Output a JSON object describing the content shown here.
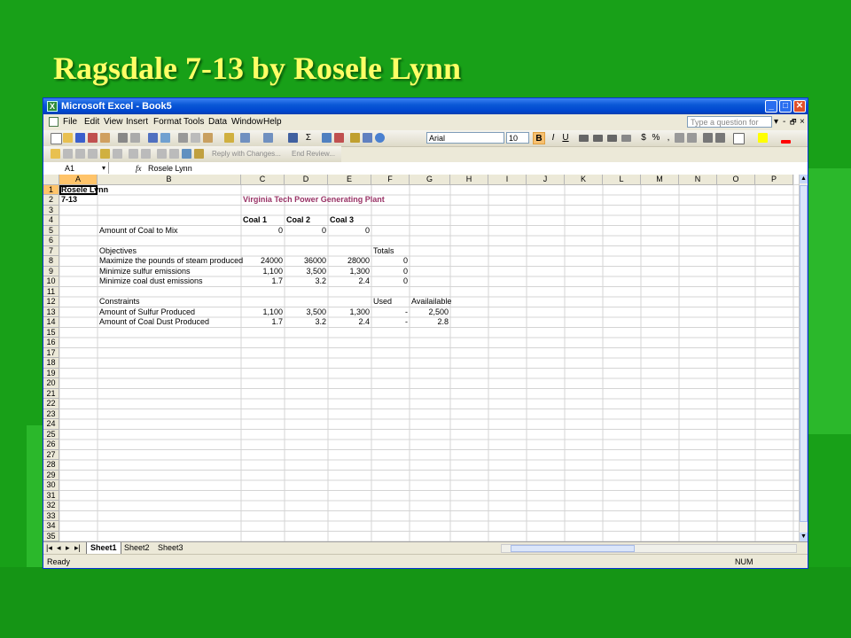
{
  "slide": {
    "title": "Ragsdale 7-13 by Rosele Lynn"
  },
  "window": {
    "title": "Microsoft Excel - Book5",
    "min": "_",
    "max": "□",
    "close": "✕"
  },
  "menu": {
    "items": [
      "File",
      "Edit",
      "View",
      "Insert",
      "Format",
      "Tools",
      "Data",
      "Window",
      "Help"
    ],
    "ask_placeholder": "Type a question for help",
    "doc_controls": [
      "▾",
      "-",
      "🗗",
      "×"
    ]
  },
  "toolbar": {
    "font_name": "Arial",
    "font_size": "10",
    "bold": "B",
    "italic": "I",
    "underline": "U",
    "currency": "$",
    "percent": "%",
    "comma": ",",
    "reply_label": "Reply with Changes...",
    "end_review_label": "End Review...",
    "sigma": "Σ"
  },
  "formula_bar": {
    "name_box": "A1",
    "fx": "fx",
    "content": "Rosele Lynn"
  },
  "columns": [
    "A",
    "B",
    "C",
    "D",
    "E",
    "F",
    "G",
    "H",
    "I",
    "J",
    "K",
    "L",
    "M",
    "N",
    "O",
    "P"
  ],
  "rows": [
    "1",
    "2",
    "3",
    "4",
    "5",
    "6",
    "7",
    "8",
    "9",
    "10",
    "11",
    "12",
    "13",
    "14",
    "15",
    "16",
    "17",
    "18",
    "19",
    "20",
    "21",
    "22",
    "23",
    "24",
    "25",
    "26",
    "27",
    "28",
    "29",
    "30",
    "31",
    "32",
    "33",
    "34",
    "35"
  ],
  "cells": {
    "A1": "Rosele Lynn",
    "A2": "7-13",
    "C2": "Virginia Tech Power Generating Plant",
    "C4": "Coal 1",
    "D4": "Coal 2",
    "E4": "Coal 3",
    "B5": "Amount of  Coal to Mix",
    "C5": "0",
    "D5": "0",
    "E5": "0",
    "B7": "Objectives",
    "F7": "Totals",
    "B8": "Maximize the pounds of steam produced",
    "C8": "24000",
    "D8": "36000",
    "E8": "28000",
    "F8": "0",
    "B9": "Minimize sulfur emissions",
    "C9": "1,100",
    "D9": "3,500",
    "E9": "1,300",
    "F9": "0",
    "B10": "Minimize coal dust emissions",
    "C10": "1.7",
    "D10": "3.2",
    "E10": "2.4",
    "F10": "0",
    "B12": "Constraints",
    "F12": "Used",
    "G12": "Availailable",
    "B13": "Amount of Sulfur Produced",
    "C13": "1,100",
    "D13": "3,500",
    "E13": "1,300",
    "F13": "-",
    "G13": "2,500",
    "B14": "Amount of Coal Dust Produced",
    "C14": "1.7",
    "D14": "3.2",
    "E14": "2.4",
    "F14": "-",
    "G14": "2.8"
  },
  "sheet_tabs": [
    "Sheet1",
    "Sheet2",
    "Sheet3"
  ],
  "status": {
    "ready": "Ready",
    "num": "NUM"
  },
  "colors": {
    "slide_bg": "#18a018",
    "title": "#ffff66",
    "accent_text": "#993366",
    "xp_blue": "#0a58d6"
  }
}
